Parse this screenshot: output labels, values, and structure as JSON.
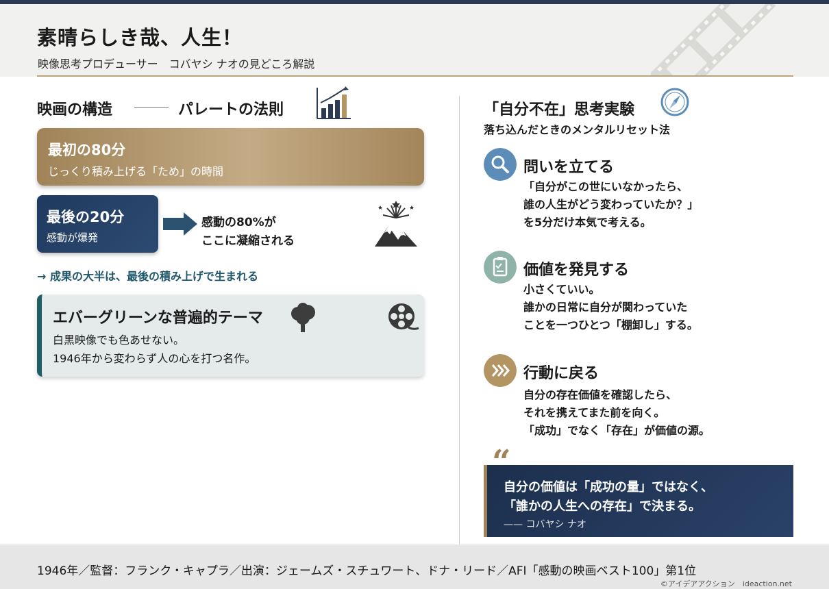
{
  "header": {
    "title": "素晴らしき哉、人生！",
    "subtitle": "映像思考プロデューサー　コバヤシ ナオの見どころ解説"
  },
  "left": {
    "section_title_a": "映画の構造",
    "section_title_b": "パレートの法則",
    "gold_card": {
      "title": "最初の80分",
      "body": "じっくり積み上げる「ため」の時間"
    },
    "navy_card": {
      "title": "最後の20分",
      "body": "感動が爆発"
    },
    "burst_line1": "感動の80%が",
    "burst_line2": "ここに凝縮される",
    "result": "→ 成果の大半は、最後の積み上げで生まれる",
    "evergreen": {
      "title": "エバーグリーンな普遍的テーマ",
      "line1": "白黒映像でも色あせない。",
      "line2": "1946年から変わらず人の心を打つ名作。"
    }
  },
  "right": {
    "title": "「自分不在」思考実験",
    "subtitle": "落ち込んだときのメンタルリセット法",
    "steps": [
      {
        "title": "問いを立てる",
        "lines": [
          "「自分がこの世にいなかったら、",
          "誰の人生がどう変わっていたか？」",
          "を5分だけ本気で考える。"
        ]
      },
      {
        "title": "価値を発見する",
        "lines": [
          "小さくていい。",
          "誰かの日常に自分が関わっていた",
          "ことを一つひとつ「棚卸し」する。"
        ]
      },
      {
        "title": "行動に戻る",
        "lines": [
          "自分の存在価値を確認したら、",
          "それを携えてまた前を向く。",
          "「成功」でなく「存在」が価値の源。"
        ]
      }
    ],
    "quote": {
      "mark": "“",
      "line1": "自分の価値は「成功の量」ではなく、",
      "line2": "「誰かの人生への存在」で決まる。",
      "author": "—— コバヤシ ナオ"
    }
  },
  "footer": {
    "info": "1946年／監督：フランク・キャプラ／出演：ジェームズ・スチュワート、ドナ・リード／AFI「感動の映画ベスト100」第1位",
    "credit": "©アイデアアクション　ideaction.net"
  },
  "colors": {
    "navy": "#1f3a5e",
    "gold": "#a08358",
    "teal": "#1f5e66",
    "search_circle": "#5b8db8",
    "clipboard_circle": "#8fb3a9",
    "chevron_circle": "#b39563"
  },
  "icons": [
    "filmstrip-icon",
    "bar-chart-icon",
    "arrow-right-icon",
    "fireworks-mountain-icon",
    "tree-icon",
    "film-reel-icon",
    "compass-icon",
    "search-icon",
    "clipboard-icon",
    "chevrons-icon",
    "quote-icon"
  ]
}
